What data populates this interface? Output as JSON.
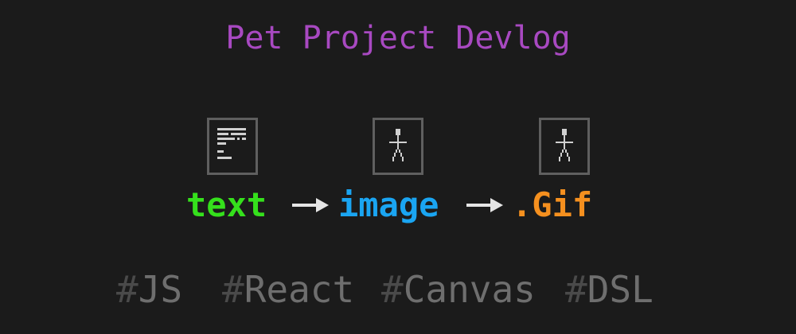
{
  "title": "Pet Project Devlog",
  "icons": {
    "first": "document-icon",
    "second": "stick-figure-icon",
    "third": "stick-figure-icon"
  },
  "pipeline": {
    "steps": [
      "text",
      "image",
      ".Gif"
    ],
    "arrow": "→"
  },
  "tags": {
    "hash": "#",
    "items": [
      "JS",
      "React",
      "Canvas",
      "DSL"
    ]
  },
  "colors": {
    "background": "#1b1b1b",
    "title": "#a849c1",
    "text": "#35e01c",
    "image": "#1aa5f2",
    "gif": "#f5901f",
    "tag": "#6e6e6e",
    "icon_border": "#5f5f5f"
  }
}
